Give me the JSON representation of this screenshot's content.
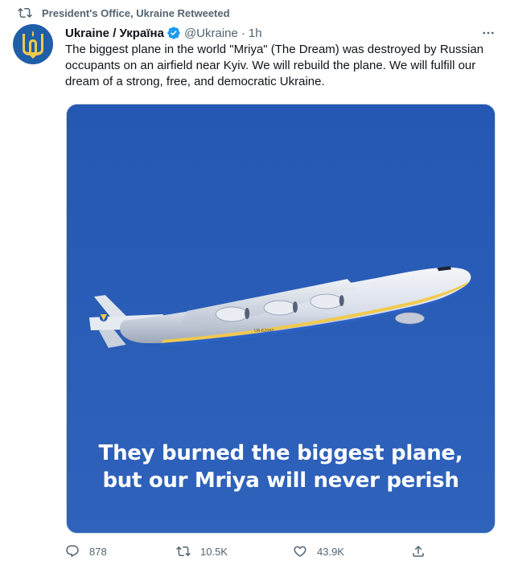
{
  "retweet_context": {
    "text": "President's Office, Ukraine Retweeted",
    "icon": "retweet-icon"
  },
  "author": {
    "display_name": "Ukraine / Україна",
    "handle": "@Ukraine",
    "separator": "·",
    "time": "1h",
    "verified": true,
    "avatar_icon": "ukraine-trident-icon"
  },
  "tweet": {
    "text": "The biggest plane in the world \"Mriya\" (The Dream) was destroyed by Russian occupants on an airfield near Kyiv. We will rebuild the plane. We will fulfill our dream of a strong, free, and democratic Ukraine."
  },
  "media": {
    "caption_line1": "They burned the biggest plane,",
    "caption_line2": "but our Mriya will never perish",
    "aircraft_registration": "UR-82060",
    "background_color": "#2a5cb5"
  },
  "actions": {
    "replies": "878",
    "retweets": "10.5K",
    "likes": "43.9K"
  },
  "colors": {
    "text": "#0f1419",
    "secondary": "#536471",
    "verified": "#1d9bf0"
  }
}
